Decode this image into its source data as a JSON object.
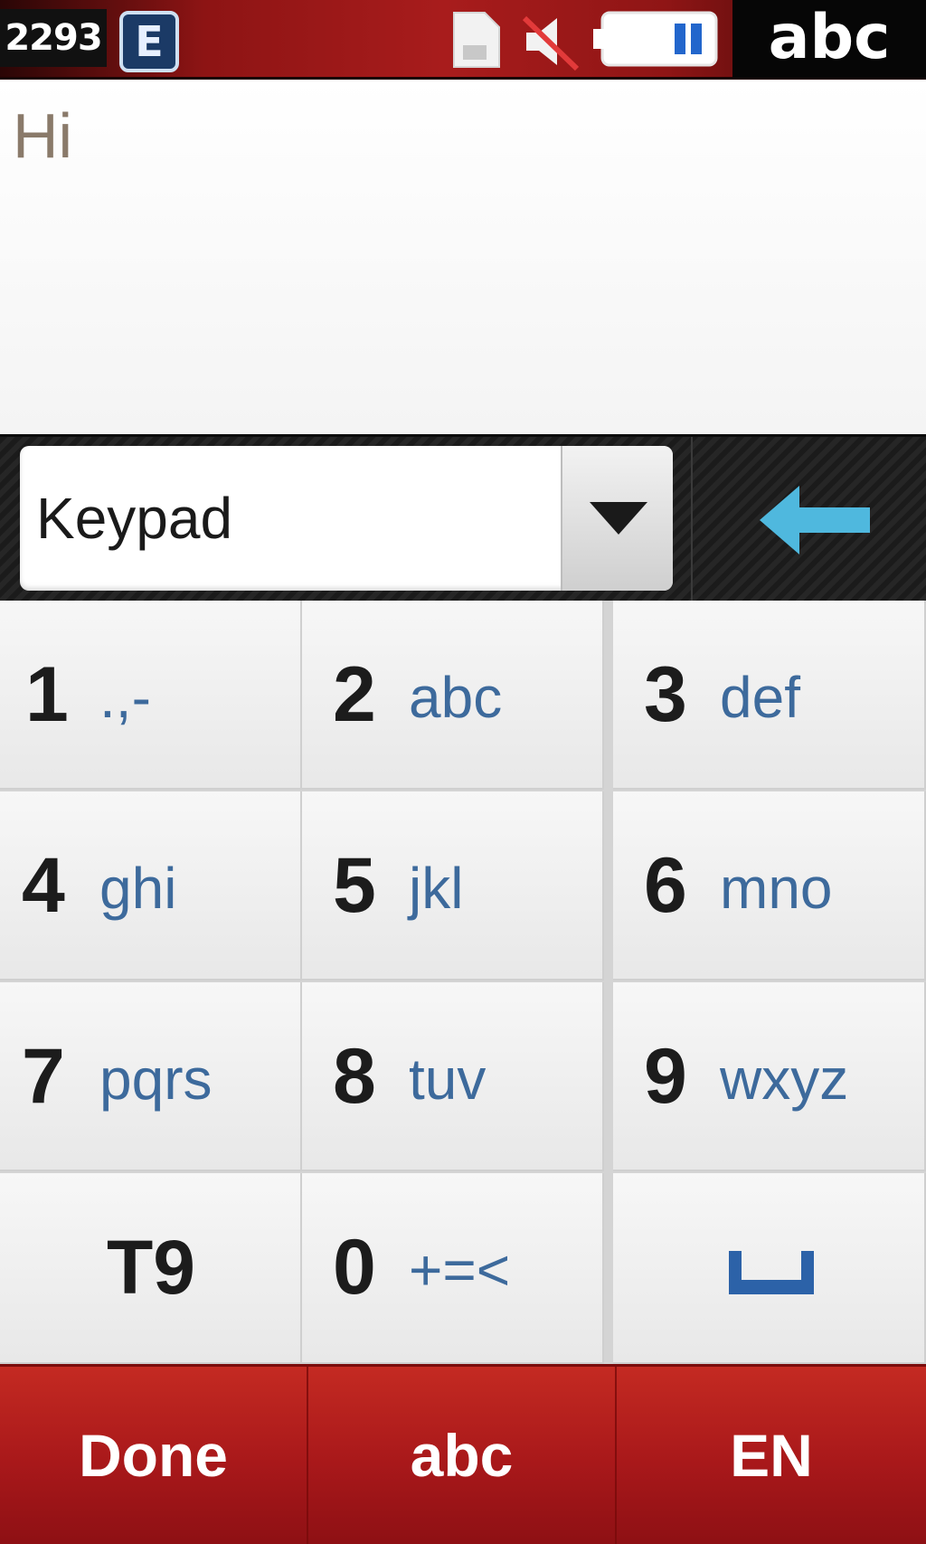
{
  "status_bar": {
    "counter": "2293",
    "network_icon_letter": "E",
    "sim_icon": "sim-card-icon",
    "mute_icon": "speaker-muted-icon",
    "battery_icon": "battery-icon",
    "input_mode": "abc",
    "colors": {
      "bar": "#a81c1c",
      "badge_bg": "#111111"
    }
  },
  "message": {
    "text": "Hi"
  },
  "mode_bar": {
    "selected_mode": "Keypad",
    "dropdown_icon": "chevron-down-icon",
    "backspace_icon": "backspace-arrow-icon",
    "colors": {
      "backspace": "#4fb8de"
    }
  },
  "keypad": {
    "keys": [
      {
        "digit": "1",
        "letters": ".,-"
      },
      {
        "digit": "2",
        "letters": "abc"
      },
      {
        "digit": "3",
        "letters": "def"
      },
      {
        "digit": "4",
        "letters": "ghi"
      },
      {
        "digit": "5",
        "letters": "jkl"
      },
      {
        "digit": "6",
        "letters": "mno"
      },
      {
        "digit": "7",
        "letters": "pqrs"
      },
      {
        "digit": "8",
        "letters": "tuv"
      },
      {
        "digit": "9",
        "letters": "wxyz"
      },
      {
        "label": "T9"
      },
      {
        "digit": "0",
        "letters": "+=<"
      },
      {
        "icon": "space-icon"
      }
    ],
    "colors": {
      "digit": "#1c1c1c",
      "letters": "#3d6a9c"
    }
  },
  "softkeys": {
    "done": "Done",
    "mode": "abc",
    "language": "EN",
    "colors": {
      "bar": "#b01e1e"
    }
  }
}
